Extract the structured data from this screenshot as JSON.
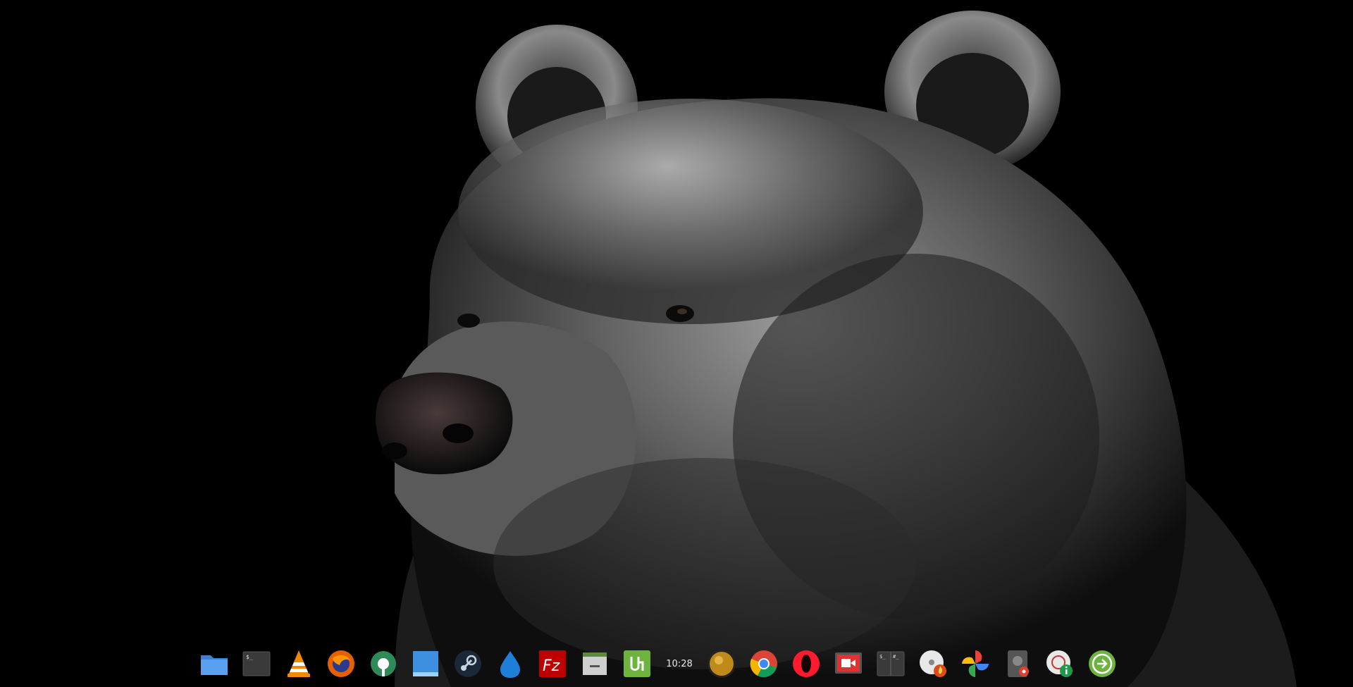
{
  "desktop": {
    "wallpaper_icon": "bear-portrait-wallpaper",
    "background_color": "#000000"
  },
  "dock": {
    "items": [
      {
        "icon": "file-manager-icon",
        "color": "#4a90e2"
      },
      {
        "icon": "terminal-icon",
        "color": "#3a3a3a"
      },
      {
        "icon": "vlc-icon",
        "color": "#f08a00"
      },
      {
        "icon": "firefox-icon",
        "color": "#e66000"
      },
      {
        "icon": "settings-icon",
        "color": "#2e8b57"
      },
      {
        "icon": "show-desktop-icon",
        "color": "#3d8fe0"
      },
      {
        "icon": "steam-icon",
        "color": "#1b2838"
      },
      {
        "icon": "water-drop-icon",
        "color": "#1e7fd8"
      },
      {
        "icon": "filezilla-icon",
        "color": "#bf0000"
      },
      {
        "icon": "archive-manager-icon",
        "color": "#c8c8c8"
      },
      {
        "icon": "upwork-icon",
        "color": "#6fb33f"
      },
      {
        "icon": "clock-applet",
        "label": "10:28"
      },
      {
        "icon": "golden-orb-icon",
        "color": "#c08a1a"
      },
      {
        "icon": "chrome-icon",
        "color": "#db4437"
      },
      {
        "icon": "opera-icon",
        "color": "#ff1b2d"
      },
      {
        "icon": "screen-recorder-icon",
        "color": "#d33"
      },
      {
        "icon": "terminal-tiling-icon",
        "color": "#3a3a3a"
      },
      {
        "icon": "disc-burner-icon",
        "color": "#e8e8e8"
      },
      {
        "icon": "photos-pinwheel-icon",
        "color": "#f4b400"
      },
      {
        "icon": "disk-settings-icon",
        "color": "#666666"
      },
      {
        "icon": "system-info-icon",
        "color": "#1f9a4a"
      },
      {
        "icon": "logout-icon",
        "color": "#6db33f"
      }
    ]
  }
}
